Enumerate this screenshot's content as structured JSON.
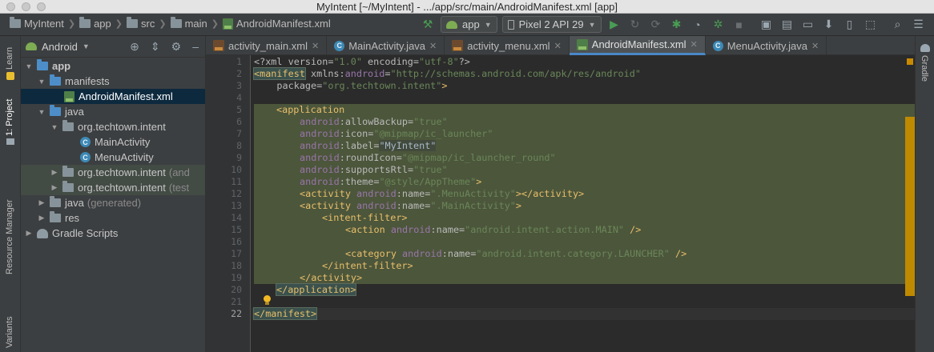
{
  "window": {
    "title": "MyIntent [~/MyIntent] - .../app/src/main/AndroidManifest.xml [app]"
  },
  "breadcrumb": {
    "items": [
      "MyIntent",
      "app",
      "src",
      "main",
      "AndroidManifest.xml"
    ]
  },
  "toolbar": {
    "config_label": "app",
    "device_label": "Pixel 2 API 29"
  },
  "left_strip": {
    "learn": "Learn",
    "project": "1: Project",
    "resource_manager": "Resource Manager",
    "variants": "Variants"
  },
  "right_strip": {
    "gradle": "Gradle"
  },
  "project_panel": {
    "view_mode": "Android",
    "tree": [
      {
        "label": "app",
        "suffix": ""
      },
      {
        "label": "manifests",
        "suffix": ""
      },
      {
        "label": "AndroidManifest.xml",
        "suffix": ""
      },
      {
        "label": "java",
        "suffix": ""
      },
      {
        "label": "org.techtown.intent",
        "suffix": ""
      },
      {
        "label": "MainActivity",
        "suffix": ""
      },
      {
        "label": "MenuActivity",
        "suffix": ""
      },
      {
        "label": "org.techtown.intent",
        "suffix": "(and"
      },
      {
        "label": "org.techtown.intent",
        "suffix": "(test"
      },
      {
        "label": "java",
        "suffix": "(generated)"
      },
      {
        "label": "res",
        "suffix": ""
      },
      {
        "label": "Gradle Scripts",
        "suffix": ""
      }
    ]
  },
  "tabs": [
    {
      "label": "activity_main.xml"
    },
    {
      "label": "MainActivity.java"
    },
    {
      "label": "activity_menu.xml"
    },
    {
      "label": "AndroidManifest.xml"
    },
    {
      "label": "MenuActivity.java"
    }
  ],
  "editor": {
    "line_numbers": [
      "1",
      "2",
      "3",
      "4",
      "5",
      "6",
      "7",
      "8",
      "9",
      "10",
      "11",
      "12",
      "13",
      "14",
      "15",
      "16",
      "17",
      "18",
      "19",
      "20",
      "21",
      "22"
    ],
    "current_line": "22",
    "code": {
      "l1_a": "<?xml version=",
      "l1_b": "\"1.0\"",
      "l1_c": " encoding=",
      "l1_d": "\"utf-8\"",
      "l1_e": "?>",
      "l2_tag": "<manifest",
      "l2_attr": " xmlns:",
      "l2_ns": "android",
      "l2_eq": "=",
      "l2_val": "\"http://schemas.android.com/apk/res/android\"",
      "l3_attr": "    package=",
      "l3_val": "\"org.techtown.intent\"",
      "l3_end": ">",
      "l5_tag": "<application",
      "l6_ns": "android",
      "l6_attr": ":allowBackup=",
      "l6_val": "\"true\"",
      "l7_ns": "android",
      "l7_attr": ":icon=",
      "l7_val": "\"@mipmap/ic_launcher\"",
      "l8_ns": "android",
      "l8_attr": ":label=",
      "l8_val": "\"MyIntent\"",
      "l9_ns": "android",
      "l9_attr": ":roundIcon=",
      "l9_val": "\"@mipmap/ic_launcher_round\"",
      "l10_ns": "android",
      "l10_attr": ":supportsRtl=",
      "l10_val": "\"true\"",
      "l11_ns": "android",
      "l11_attr": ":theme=",
      "l11_val": "\"@style/AppTheme\"",
      "l11_end": ">",
      "l12_tag": "<activity",
      "l12_ns": " android",
      "l12_attr": ":name=",
      "l12_val": "\".MenuActivity\"",
      "l12_end": "></activity>",
      "l13_tag": "<activity",
      "l13_ns": " android",
      "l13_attr": ":name=",
      "l13_val": "\".MainActivity\"",
      "l13_end": ">",
      "l14_tag": "<intent-filter>",
      "l15_tag": "<action",
      "l15_ns": " android",
      "l15_attr": ":name=",
      "l15_val": "\"android.intent.action.MAIN\"",
      "l15_end": " />",
      "l17_tag": "<category",
      "l17_ns": " android",
      "l17_attr": ":name=",
      "l17_val": "\"android.intent.category.LAUNCHER\"",
      "l17_end": " />",
      "l18_tag": "</intent-filter>",
      "l19_tag": "</activity>",
      "l20_tag": "</application>",
      "l22_tag": "</manifest>"
    }
  },
  "colors": {
    "editor_bg": "#2b2b2b",
    "tag": "#e8bf6a",
    "value": "#6a8759",
    "namespace": "#9876aa",
    "selection": "#0d293e",
    "highlight_block": "#525e3e",
    "marker": "#bf8a00"
  }
}
